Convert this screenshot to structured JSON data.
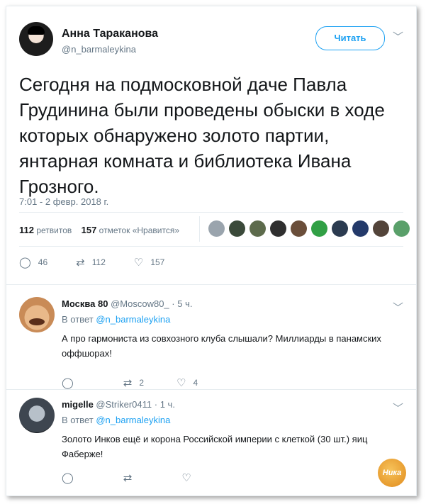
{
  "tweet": {
    "author_name": "Анна Тараканова",
    "author_handle": "@n_barmaleykina",
    "follow_label": "Читать",
    "text": "Сегодня на подмосковной даче Павла Грудинина были проведены обыски в ходе которых обнаружено золото партии, янтарная комната и библиотека Ивана Грозного.",
    "timestamp": "7:01 - 2 февр. 2018 г.",
    "retweets_count": "112",
    "retweets_label": "ретвитов",
    "likes_count": "157",
    "likes_label": "отметок «Нравится»",
    "actions": {
      "replies": "46",
      "retweets": "112",
      "likes": "157"
    }
  },
  "liker_colors": [
    "#9aa4ad",
    "#3b4a3a",
    "#5d6b4c",
    "#2f2f2f",
    "#6a4e3a",
    "#31a045",
    "#2b3b50",
    "#243a6a",
    "#53443a",
    "#5aa06a"
  ],
  "replies": [
    {
      "name": "Москва 80",
      "handle": "@Moscow80_",
      "age": "· 5 ч.",
      "reply_to_prefix": "В ответ",
      "reply_to": "@n_barmaleykina",
      "text": "А про гармониста из совхозного клуба слышали? Миллиарды в панамских оффшорах!",
      "retweets": "2",
      "likes": "4"
    },
    {
      "name": "migelle",
      "handle": "@Striker0411",
      "age": "· 1 ч.",
      "reply_to_prefix": "В ответ",
      "reply_to": "@n_barmaleykina",
      "text": "Золото Инков ещё и корона Российской империи с клеткой (30 шт.) яиц Фаберже!",
      "retweets": "",
      "likes": ""
    }
  ],
  "watermark": "Ника"
}
